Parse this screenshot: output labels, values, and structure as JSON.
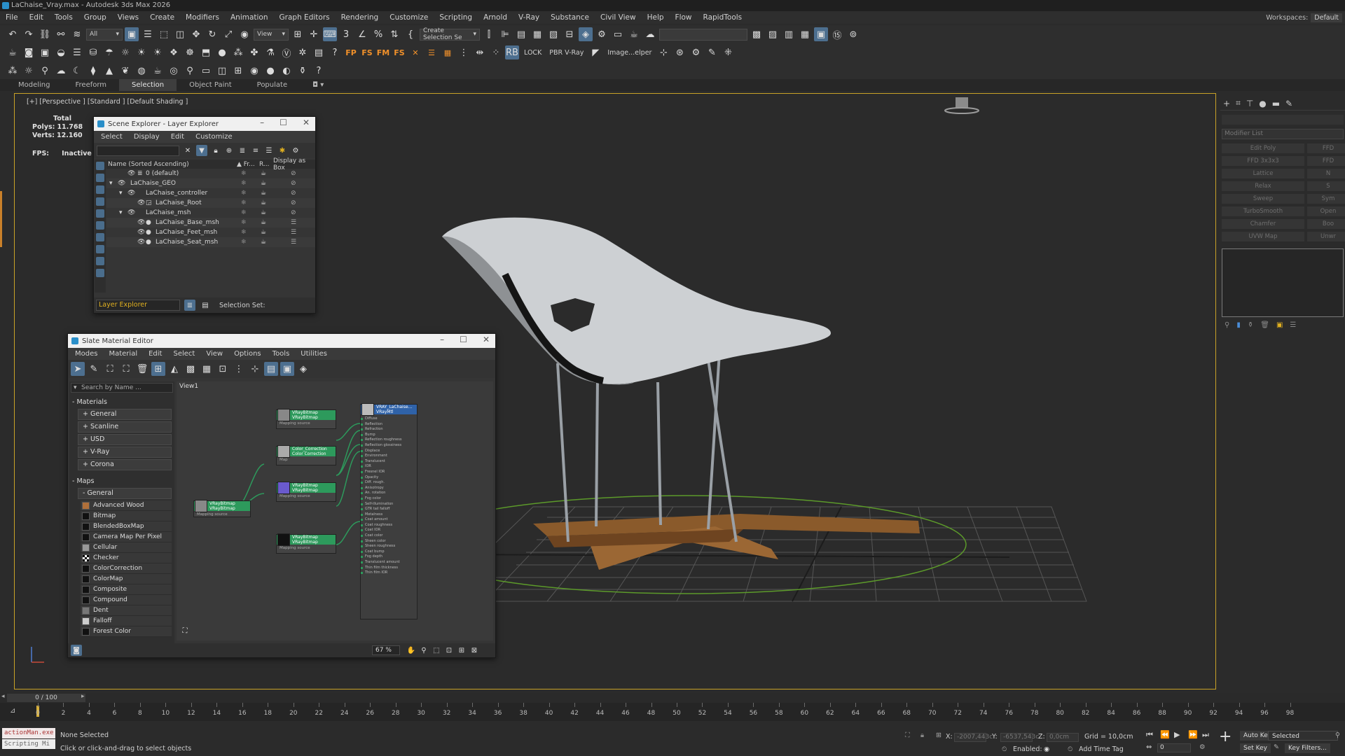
{
  "window": {
    "title": "LaChaise_Vray.max - Autodesk 3ds Max 2026"
  },
  "menu": [
    "File",
    "Edit",
    "Tools",
    "Group",
    "Views",
    "Create",
    "Modifiers",
    "Animation",
    "Graph Editors",
    "Rendering",
    "Customize",
    "Scripting",
    "Arnold",
    "V-Ray",
    "Substance",
    "Civil View",
    "Help",
    "Flow",
    "RapidTools"
  ],
  "workspace": {
    "label": "Workspaces:",
    "value": "Default"
  },
  "toolbar": {
    "filter": "All",
    "view": "View",
    "selection_set": "Create Selection Se",
    "lock": "LOCK",
    "pbr": "PBR V-Ray",
    "image_helper": "Image...elper",
    "fp_labels": [
      "FP",
      "FS",
      "FM",
      "FS"
    ],
    "rb": "RB"
  },
  "ribbon": {
    "tabs": [
      "Modeling",
      "Freeform",
      "Selection",
      "Object Paint",
      "Populate"
    ],
    "active": "Selection"
  },
  "viewport": {
    "label": "[+] [Perspective ] [Standard ] [Default Shading ]",
    "stats": {
      "header": "Total",
      "polys_label": "Polys:",
      "polys": "11.768",
      "verts_label": "Verts:",
      "verts": "12.160"
    },
    "fps_label": "FPS:",
    "fps_value": "Inactive"
  },
  "scene_explorer": {
    "title": "Scene Explorer - Layer Explorer",
    "menu": [
      "Select",
      "Display",
      "Edit",
      "Customize"
    ],
    "columns": [
      "Name (Sorted Ascending)",
      "▲ Fr...",
      "R...",
      "Display as Box"
    ],
    "rows": [
      {
        "name": "0 (default)",
        "indent": 0
      },
      {
        "name": "LaChaise_GEO",
        "indent": 0
      },
      {
        "name": "LaChaise_controller",
        "indent": 1
      },
      {
        "name": "LaChaise_Root",
        "indent": 2
      },
      {
        "name": "LaChaise_msh",
        "indent": 1
      },
      {
        "name": "LaChaise_Base_msh",
        "indent": 2
      },
      {
        "name": "LaChaise_Feet_msh",
        "indent": 2
      },
      {
        "name": "LaChaise_Seat_msh",
        "indent": 2
      }
    ],
    "footer_dropdown": "Layer Explorer",
    "selection_set_label": "Selection Set:"
  },
  "slate": {
    "title": "Slate Material Editor",
    "menu": [
      "Modes",
      "Material",
      "Edit",
      "Select",
      "View",
      "Options",
      "Tools",
      "Utilities"
    ],
    "search_placeholder": "Search by Name ...",
    "materials_header": "- Materials",
    "material_groups": [
      "+ General",
      "+ Scanline",
      "+ USD",
      "+ V-Ray",
      "+ Corona"
    ],
    "maps_header": "- Maps",
    "maps_general": "- General",
    "maps": [
      "Advanced Wood",
      "Bitmap",
      "BlendedBoxMap",
      "Camera Map Per Pixel",
      "Cellular",
      "Checker",
      "ColorCorrection",
      "ColorMap",
      "Composite",
      "Compound",
      "Dent",
      "Falloff",
      "Forest Color"
    ],
    "view_tab": "View1",
    "zoom": "67 %",
    "nodes": {
      "bitmap_a": {
        "title": "VRayBitmap",
        "sub": "VRayBitmap",
        "slot": "Mapping source"
      },
      "color_corr": {
        "title": "Color_Correction",
        "sub": "Color Correction",
        "slot": "Map"
      },
      "bitmap_b": {
        "title": "VRayBitmap",
        "sub": "VRayBitmap",
        "slot": "Mapping source"
      },
      "bitmap_c": {
        "title": "VRayBitmap",
        "sub": "VRayBitmap",
        "slot": "Mapping source"
      },
      "bitmap_d": {
        "title": "VRayBitmap",
        "sub": "VRayBitmap",
        "slot": "Mapping source"
      },
      "material": {
        "title": "VRAY_LaChaise...",
        "sub": "VRayMtl",
        "slots": [
          "Diffuse",
          "Reflection",
          "Refraction",
          "Bump",
          "Reflection roughness",
          "Reflection glossiness",
          "Displace",
          "Environment",
          "Translucent",
          "IOR",
          "Fresnel IOR",
          "Opacity",
          "Diff. rough.",
          "Anisotropy",
          "An. rotation",
          "Fog color",
          "Self-illumination",
          "GTR tail falloff",
          "Metalness",
          "Coat amount",
          "Coat roughness",
          "Coat IOR",
          "Coat color",
          "Sheen color",
          "Sheen roughness",
          "Coat bump",
          "Fog depth",
          "Translucent amount",
          "Thin film thickness",
          "Thin film IOR"
        ]
      }
    }
  },
  "command_panel": {
    "modifier_list": "Modifier List",
    "buttons": [
      "Edit Poly",
      "FFD",
      "FFD 3x3x3",
      "FFD",
      "Lattice",
      "N",
      "Relax",
      "S",
      "Sweep",
      "Sym",
      "TurboSmooth",
      "Open",
      "Chamfer",
      "Boo",
      "UVW Map",
      "Unwr"
    ]
  },
  "timeline": {
    "slider": "0 / 100",
    "ticks": [
      0,
      2,
      4,
      6,
      8,
      10,
      12,
      14,
      16,
      18,
      20,
      22,
      24,
      26,
      28,
      30,
      32,
      34,
      36,
      38,
      40,
      42,
      44,
      46,
      48,
      50,
      52,
      54,
      56,
      58,
      60,
      62,
      64,
      66,
      68,
      70,
      72,
      74,
      76,
      78,
      80,
      82,
      84,
      86,
      88,
      90,
      92,
      94,
      96,
      98
    ]
  },
  "status": {
    "maxscript_1": "actionMan.exe",
    "maxscript_2": "Scripting Mi",
    "selection": "None Selected",
    "prompt": "Click or click-and-drag to select objects",
    "x_label": "X:",
    "x_val": "-2007,443c",
    "y_label": "Y:",
    "y_val": "-6537,543c",
    "z_label": "Z:",
    "z_val": "0,0cm",
    "grid": "Grid = 10,0cm",
    "enabled": "Enabled:",
    "add_time_tag": "Add Time Tag",
    "auto_key": "Auto Key",
    "selected": "Selected",
    "set_key": "Set Key",
    "key_filters": "Key Filters...",
    "frame": "0"
  },
  "colors": {
    "accent": "#c9a227",
    "highlight": "#4d6f8f",
    "node_green": "#2d9a5c",
    "node_blue": "#2f62a8"
  }
}
